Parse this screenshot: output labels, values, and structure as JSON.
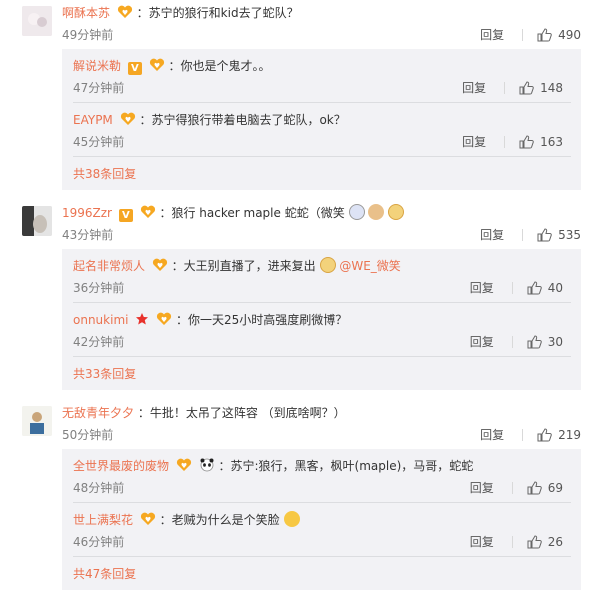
{
  "threads": [
    {
      "user": "啊酥本苏",
      "text": "：苏宁的狼行和kid去了蛇队？",
      "time": "49分钟前",
      "reply": "回复",
      "likes": "490",
      "subs": [
        {
          "user": "解说米勒",
          "text": "：你也是个鬼才。。",
          "time": "47分钟前",
          "reply": "回复",
          "likes": "148"
        },
        {
          "user": "EAYPM",
          "text": "：苏宁得狼行带着电脑去了蛇队，ok？",
          "time": "45分钟前",
          "reply": "回复",
          "likes": "163"
        }
      ],
      "more": "共38条回复"
    },
    {
      "user": "1996Zzr",
      "text": "：狼行 hacker maple 蛇蛇（微笑",
      "time": "43分钟前",
      "reply": "回复",
      "likes": "535",
      "subs": [
        {
          "user": "起名非常烦人",
          "text": "：大王别直播了，进来复出",
          "mention": "@WE_微笑",
          "time": "36分钟前",
          "reply": "回复",
          "likes": "40"
        },
        {
          "user": "onnukimi",
          "text": "：你一天25小时高强度刷微博？",
          "time": "42分钟前",
          "reply": "回复",
          "likes": "30"
        }
      ],
      "more": "共33条回复"
    },
    {
      "user": "无敌青年夕夕",
      "text": "：牛批！太吊了这阵容 （到底啥啊？）",
      "time": "50分钟前",
      "reply": "回复",
      "likes": "219",
      "subs": [
        {
          "user": "全世界最废的废物",
          "text": "：苏宁:狼行，黑客，枫叶(maple)，马哥，蛇蛇",
          "time": "48分钟前",
          "reply": "回复",
          "likes": "69"
        },
        {
          "user": "世上满梨花",
          "text": "：老贼为什么是个笑脸",
          "time": "46分钟前",
          "reply": "回复",
          "likes": "26"
        }
      ],
      "more": "共47条回复"
    }
  ],
  "colors": {
    "username": "#eb7350",
    "subbox": "#f2f2f5",
    "time": "#808080"
  }
}
